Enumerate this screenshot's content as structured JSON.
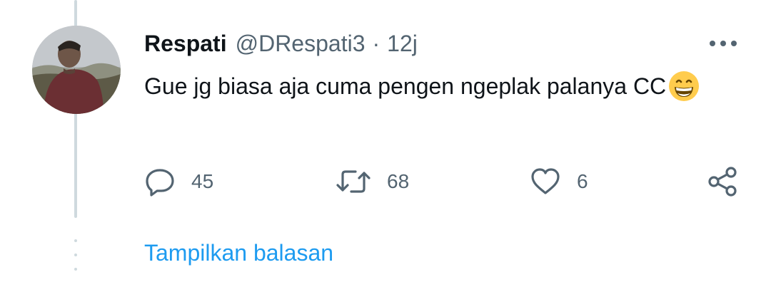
{
  "tweet": {
    "author_name": "Respati",
    "handle": "@DRespati3",
    "separator": "·",
    "time": "12j",
    "text": "Gue jg biasa aja cuma pengen ngeplak palanya CC",
    "emoji": "grinning-face-emoji"
  },
  "actions": {
    "reply_count": "45",
    "retweet_count": "68",
    "like_count": "6"
  },
  "thread": {
    "show_replies_label": "Tampilkan balasan"
  },
  "colors": {
    "link": "#1d9bf0",
    "muted": "#536471",
    "text": "#0f1419",
    "thread_line": "#cfd9de"
  }
}
